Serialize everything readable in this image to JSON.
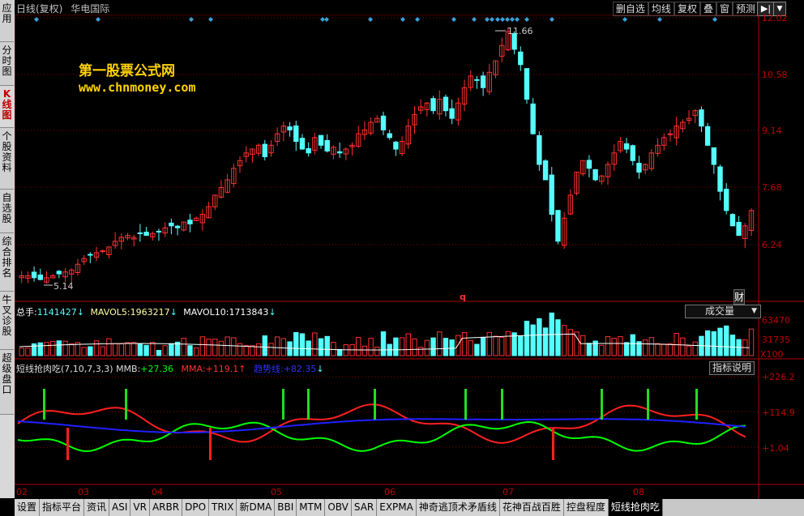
{
  "header": {
    "period": "日线(复权)",
    "stock_name": "华电国际"
  },
  "toolbar": [
    "删自选",
    "均线",
    "复权",
    "叠",
    "窗",
    "预测"
  ],
  "toolbar_arrow": "▶|",
  "toolbar_dropdown": "▼",
  "left_tabs": [
    {
      "label": "应\n用",
      "active": false
    },
    {
      "label": "分\n时\n图",
      "active": false
    },
    {
      "label": "K\n线\n图",
      "active": true
    },
    {
      "label": "个\n股\n资\n料",
      "active": false
    },
    {
      "label": "自\n选\n股",
      "active": false
    },
    {
      "label": "综\n合\n排\n名",
      "active": false
    },
    {
      "label": "牛\n叉\n诊\n股",
      "active": false
    },
    {
      "label": "超\n级\n盘\n口",
      "active": false
    }
  ],
  "watermark": {
    "line1": "第一股票公式网",
    "line2": "www.chnmoney.com"
  },
  "price_axis": [
    "12.02",
    "10.58",
    "9.14",
    "7.68",
    "6.24"
  ],
  "price_annotations": {
    "high": "11.66",
    "low": "5.14",
    "marker_q": "q",
    "marker_cai": "财"
  },
  "volume_header": {
    "label": "总手:",
    "value": "1141427",
    "mavol5_label": "MAVOL5:",
    "mavol5": "1963217",
    "mavol10_label": "MAVOL10:",
    "mavol10": "1713843"
  },
  "volume_axis": [
    "63470",
    "31735",
    "X100"
  ],
  "volume_dropdown": "成交量",
  "indicator_header": {
    "name": "短线抢肉吃(7,10,7,3,3)",
    "mmb_label": "MMB:",
    "mmb": "+27.36",
    "mma_label": "MMA:",
    "mma": "+119.1",
    "trend_label": "趋势线:",
    "trend": "+82.35"
  },
  "indicator_axis": [
    "+226.2",
    "+114.9",
    "+1.04"
  ],
  "help_button": "指标说明",
  "month_labels": [
    "02",
    "03",
    "04",
    "05",
    "06",
    "07",
    "08"
  ],
  "bottom_tabs": [
    "设置",
    "指标平台",
    "资讯",
    "ASI",
    "VR",
    "ARBR",
    "DPO",
    "TRIX",
    "新DMA",
    "BBI",
    "MTM",
    "OBV",
    "SAR",
    "EXPMA",
    "神奇逃顶术矛盾线",
    "花神百战百胜",
    "控盘程度",
    "短线抢肉吃"
  ],
  "active_bottom_tab": "短线抢肉吃",
  "colors": {
    "up": "#ff3030",
    "down": "#54ffff",
    "grid": "#8b0000",
    "ma": "#ffffff",
    "mmb": "#00ff00",
    "mma": "#ff2020",
    "trend": "#2020ff"
  },
  "chart_data": {
    "type": "candlestick",
    "y_range": [
      5.14,
      12.02
    ],
    "prices": [
      5.3,
      5.3,
      5.25,
      5.2,
      5.25,
      5.3,
      5.35,
      5.4,
      5.45,
      5.6,
      5.75,
      5.85,
      5.9,
      5.95,
      6.05,
      6.2,
      6.3,
      6.35,
      6.3,
      6.4,
      6.35,
      6.4,
      6.45,
      6.55,
      6.6,
      6.55,
      6.7,
      6.65,
      6.8,
      6.9,
      7.1,
      7.4,
      7.6,
      7.8,
      8.1,
      8.3,
      8.5,
      8.6,
      8.7,
      8.4,
      8.7,
      9.0,
      9.2,
      9.1,
      8.8,
      8.6,
      8.5,
      8.9,
      8.7,
      8.55,
      8.65,
      8.5,
      8.6,
      8.7,
      9.0,
      9.1,
      9.3,
      9.4,
      9.1,
      8.9,
      8.6,
      8.8,
      9.2,
      9.5,
      9.7,
      9.8,
      9.6,
      9.9,
      9.6,
      9.4,
      9.8,
      10.2,
      10.5,
      10.4,
      10.2,
      10.6,
      10.9,
      11.3,
      11.66,
      11.2,
      10.8,
      9.9,
      9.0,
      8.2,
      7.8,
      6.9,
      6.2,
      6.8,
      7.4,
      8.0,
      8.3,
      8.1,
      7.8,
      7.9,
      8.2,
      8.5,
      8.8,
      8.6,
      8.3,
      8.0,
      8.2,
      8.5,
      8.7,
      8.9,
      9.0,
      9.2,
      9.3,
      9.4,
      9.6,
      9.2,
      8.7,
      8.2,
      7.5,
      7.0,
      6.6,
      6.35,
      6.6,
      7.0
    ]
  }
}
